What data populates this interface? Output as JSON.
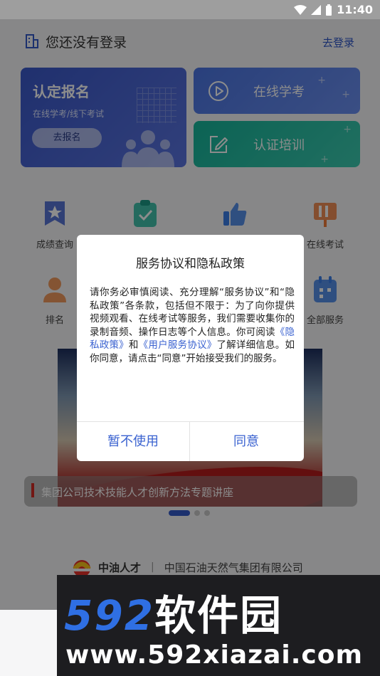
{
  "status_bar": {
    "time": "11:40"
  },
  "header": {
    "title": "您还没有登录",
    "login_link": "去登录"
  },
  "signup_card": {
    "title": "认定报名",
    "subtitle": "在线学考/线下考试",
    "button": "去报名"
  },
  "exam_card": {
    "label": "在线学考"
  },
  "training_card": {
    "label": "认证培训"
  },
  "services_row1": [
    {
      "label": "成绩查询",
      "icon": "star-badge-icon",
      "color": "#3c5fcf"
    },
    {
      "label": "",
      "icon": "check-clipboard-icon",
      "color": "#23b79f"
    },
    {
      "label": "",
      "icon": "thumbs-up-icon",
      "color": "#3b7ee8"
    },
    {
      "label": "在线考试",
      "icon": "exam-board-icon",
      "color": "#ef7b3a"
    }
  ],
  "services_row2": [
    {
      "label": "排名",
      "icon": "person-icon",
      "color": "#f08a43"
    },
    {
      "label": "全部服务",
      "icon": "calendar-grid-icon",
      "color": "#3b7ee8"
    }
  ],
  "banner": {
    "caption": "集团公司技术技能人才创新方法专题讲座",
    "page_count": 3,
    "active_page": 1
  },
  "footer": {
    "brand": "中油人才",
    "separator": "|",
    "org": "中国石油天然气集团有限公司"
  },
  "dialog": {
    "title": "服务协议和隐私政策",
    "body_part1": "请你务必审慎阅读、充分理解“服务协议”和“隐私政策”各条款，包括但不限于：为了向你提供视频观看、在线考试等服务，我们需要收集你的录制音频、操作日志等个人信息。你可阅读",
    "privacy_link": "《隐私政策》",
    "body_and": "和",
    "user_agreement_link": "《用户服务协议》",
    "body_part2": "了解详细信息。如你同意，请点击“同意”开始接受我们的服务。",
    "decline_button": "暂不使用",
    "agree_button": "同意"
  },
  "watermark": {
    "brand_number": "592",
    "brand_text": "软件园",
    "url": "www.592xiazai.com"
  }
}
